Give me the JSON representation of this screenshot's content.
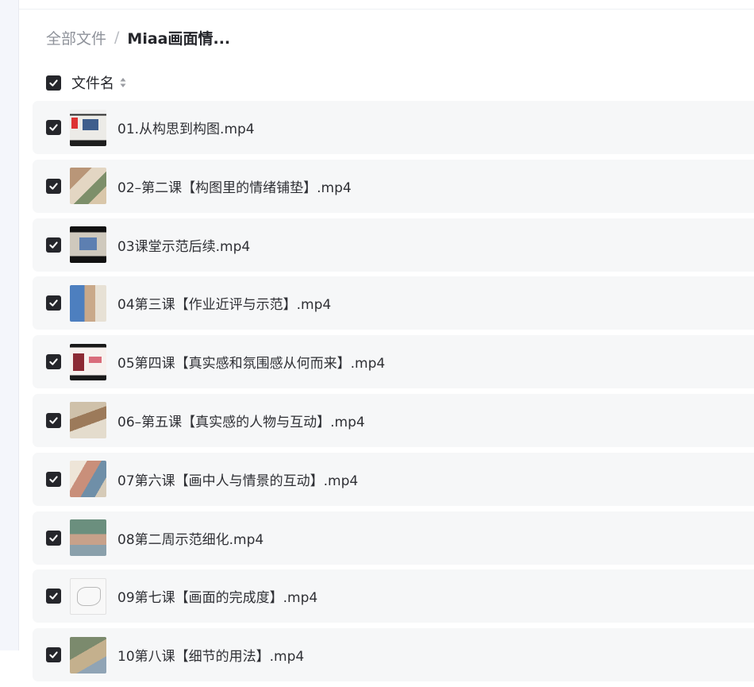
{
  "breadcrumb": {
    "root": "全部文件",
    "separator": "/",
    "current": "Miaa画面情..."
  },
  "list_header": {
    "label": "文件名",
    "select_all_checked": true
  },
  "files": [
    {
      "name": "01.从构思到构图.mp4",
      "checked": true
    },
    {
      "name": "02–第二课【构图里的情绪铺垫】.mp4",
      "checked": true
    },
    {
      "name": "03课堂示范后续.mp4",
      "checked": true
    },
    {
      "name": "04第三课【作业近评与示范】.mp4",
      "checked": true
    },
    {
      "name": "05第四课【真实感和氛围感从何而来】.mp4",
      "checked": true
    },
    {
      "name": "06–第五课【真实感的人物与互动】.mp4",
      "checked": true
    },
    {
      "name": "07第六课【画中人与情景的互动】.mp4",
      "checked": true
    },
    {
      "name": "08第二周示范细化.mp4",
      "checked": true
    },
    {
      "name": "09第七课【画面的完成度】.mp4",
      "checked": true
    },
    {
      "name": "10第八课【细节的用法】.mp4",
      "checked": true
    }
  ],
  "colors": {
    "row_background": "#f6f7f8",
    "checkbox_fill": "#25262b",
    "muted_text": "#8f939b"
  }
}
